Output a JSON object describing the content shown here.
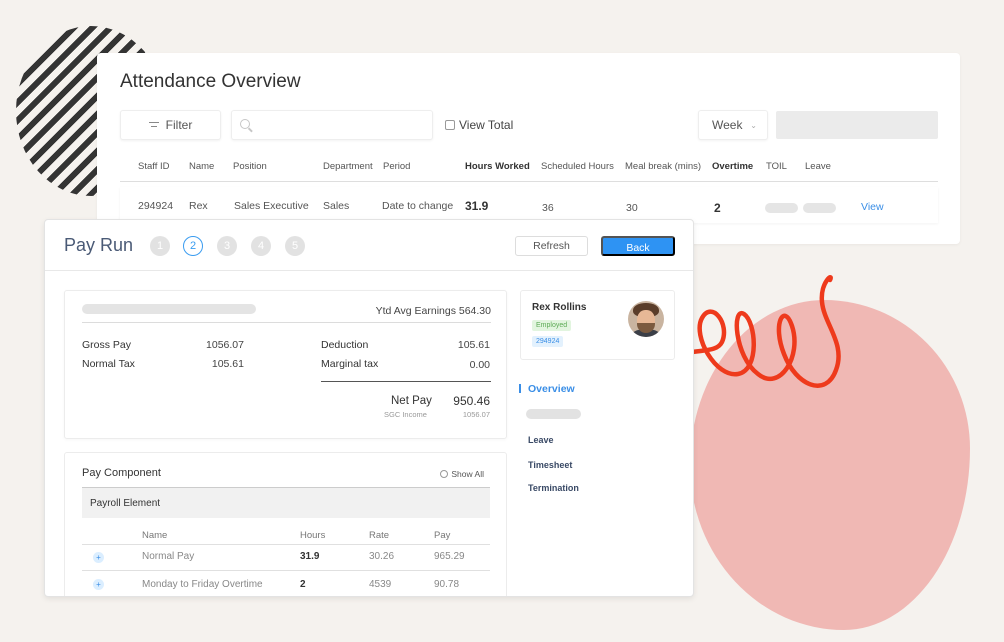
{
  "attendance": {
    "title": "Attendance Overview",
    "filter_label": "Filter",
    "search_placeholder": "",
    "view_total_label": "View Total",
    "period_select": "Week",
    "columns": [
      "Staff ID",
      "Name",
      "Position",
      "Department",
      "Period",
      "Hours Worked",
      "Scheduled Hours",
      "Meal break (mins)",
      "Overtime",
      "TOIL",
      "Leave"
    ],
    "row": {
      "staff_id": "294924",
      "name": "Rex",
      "position": "Sales Executive",
      "department": "Sales",
      "period": "Date to change",
      "hours_worked": "31.9",
      "scheduled_hours": "36",
      "meal_break": "30",
      "overtime": "2",
      "view_label": "View"
    }
  },
  "payrun": {
    "title": "Pay Run",
    "steps": [
      "1",
      "2",
      "3",
      "4",
      "5"
    ],
    "active_step": 2,
    "refresh_label": "Refresh",
    "back_label": "Back",
    "summary": {
      "ytd": "Ytd Avg Earnings 564.30",
      "gross_pay_label": "Gross Pay",
      "gross_pay": "1056.07",
      "normal_tax_label": "Normal Tax",
      "normal_tax": "105.61",
      "deduction_label": "Deduction",
      "deduction": "105.61",
      "marginal_tax_label": "Marginal tax",
      "marginal_tax": "0.00",
      "net_pay_label": "Net Pay",
      "net_pay": "950.46",
      "sgc_label": "SGC Income",
      "sgc_value": "1056.07"
    },
    "components": {
      "title": "Pay Component",
      "show_all_label": "Show All",
      "section_label": "Payroll Element",
      "columns": [
        "Name",
        "Hours",
        "Rate",
        "Pay"
      ],
      "rows": [
        {
          "name": "Normal Pay",
          "hours": "31.9",
          "rate": "30.26",
          "pay": "965.29"
        },
        {
          "name": "Monday to Friday Overtime",
          "hours": "2",
          "rate": "4539",
          "pay": "90.78"
        }
      ],
      "expand_glyph": "+"
    },
    "profile": {
      "name": "Rex Rollins",
      "status": "Employed",
      "id": "294924"
    },
    "nav": {
      "active": "Overview",
      "items": [
        "Leave",
        "Timesheet",
        "Termination"
      ]
    }
  },
  "colors": {
    "accent": "#2e93f3",
    "blob": "#f0b8b4",
    "spiral": "#ee3a1c"
  }
}
